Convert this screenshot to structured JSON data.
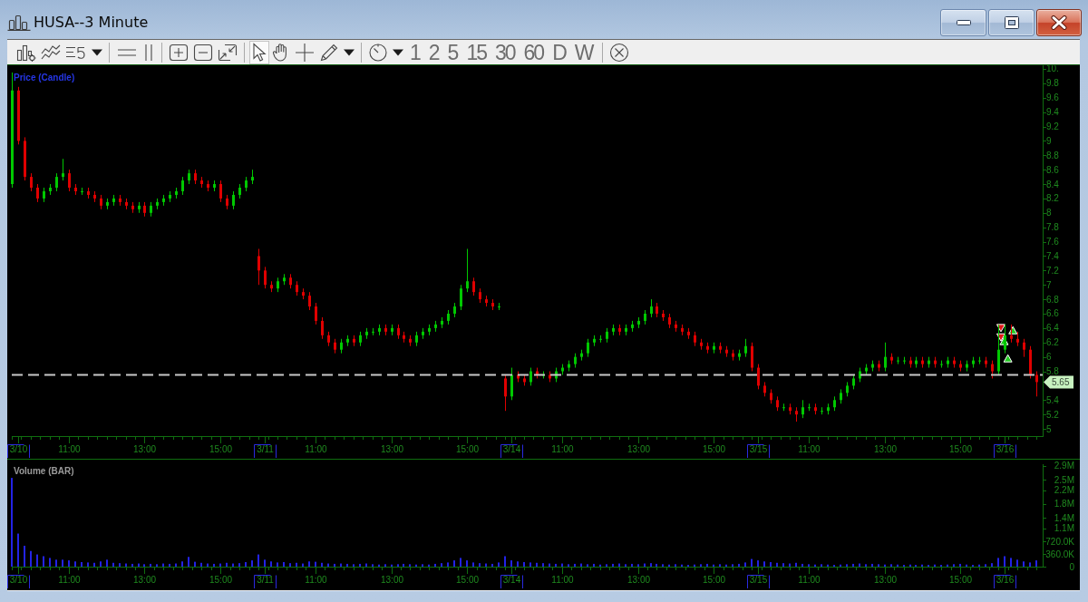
{
  "window": {
    "title": "HUSA--3 Minute"
  },
  "toolbar": {
    "tools": [
      {
        "kind": "pointer",
        "selected": true
      },
      {
        "kind": "hand",
        "selected": false
      },
      {
        "kind": "crosshair",
        "selected": false
      },
      {
        "kind": "pencil",
        "selected": false
      }
    ],
    "intervals": [
      {
        "label": "1",
        "selected": false
      },
      {
        "label": "2",
        "selected": false
      },
      {
        "label": "5",
        "selected": false
      },
      {
        "label": "15",
        "selected": false
      },
      {
        "label": "30",
        "selected": false
      },
      {
        "label": "60",
        "selected": false
      },
      {
        "label": "D",
        "selected": false
      },
      {
        "label": "W",
        "selected": false
      }
    ]
  },
  "price_panel": {
    "trade_markers": [
      {
        "kind": "sell"
      },
      {
        "kind": "sell"
      },
      {
        "kind": "buy"
      },
      {
        "kind": "buy"
      },
      {
        "kind": "buy"
      }
    ],
    "chart_data": {
      "type": "candlestick",
      "title": "Price (Candle)",
      "categories": [
        null,
        "3/10",
        null,
        null,
        null,
        null,
        null,
        null,
        null,
        "11:00",
        null,
        null,
        null,
        null,
        null,
        null,
        null,
        null,
        null,
        null,
        null,
        "13:00",
        null,
        null,
        null,
        null,
        null,
        null,
        null,
        null,
        null,
        null,
        null,
        "15:00",
        null,
        null,
        null,
        null,
        null,
        null,
        "3/11",
        null,
        null,
        null,
        null,
        null,
        null,
        null,
        "11:00",
        null,
        null,
        null,
        null,
        null,
        null,
        null,
        null,
        null,
        null,
        null,
        "13:00",
        null,
        null,
        null,
        null,
        null,
        null,
        null,
        null,
        null,
        null,
        null,
        "15:00",
        null,
        null,
        null,
        null,
        null,
        null,
        "3/14",
        null,
        null,
        null,
        null,
        null,
        null,
        null,
        "11:00",
        null,
        null,
        null,
        null,
        null,
        null,
        null,
        null,
        null,
        null,
        null,
        "13:00",
        null,
        null,
        null,
        null,
        null,
        null,
        null,
        null,
        null,
        null,
        null,
        "15:00",
        null,
        null,
        null,
        null,
        null,
        null,
        "3/15",
        null,
        null,
        null,
        null,
        null,
        null,
        null,
        "11:00",
        null,
        null,
        null,
        null,
        null,
        null,
        null,
        null,
        null,
        null,
        null,
        "13:00",
        null,
        null,
        null,
        null,
        null,
        null,
        null,
        null,
        null,
        null,
        null,
        "15:00",
        null,
        null,
        null,
        null,
        null,
        null,
        "3/16",
        null,
        null,
        null,
        null,
        null
      ],
      "ohlc": [
        [
          8.4,
          9.95,
          8.35,
          9.7
        ],
        [
          9.7,
          9.75,
          8.95,
          9.0
        ],
        [
          9.0,
          9.05,
          8.45,
          8.5
        ],
        [
          8.5,
          8.55,
          8.3,
          8.35
        ],
        [
          8.35,
          8.4,
          8.15,
          8.2
        ],
        [
          8.2,
          8.35,
          8.15,
          8.3
        ],
        [
          8.3,
          8.4,
          8.25,
          8.35
        ],
        [
          8.35,
          8.55,
          8.3,
          8.5
        ],
        [
          8.5,
          8.75,
          8.45,
          8.55
        ],
        [
          8.55,
          8.6,
          8.3,
          8.35
        ],
        [
          8.35,
          8.4,
          8.25,
          8.3
        ],
        [
          8.3,
          8.35,
          8.25,
          8.3
        ],
        [
          8.3,
          8.35,
          8.2,
          8.25
        ],
        [
          8.25,
          8.3,
          8.15,
          8.2
        ],
        [
          8.2,
          8.25,
          8.05,
          8.1
        ],
        [
          8.1,
          8.2,
          8.05,
          8.15
        ],
        [
          8.15,
          8.25,
          8.1,
          8.2
        ],
        [
          8.2,
          8.25,
          8.1,
          8.15
        ],
        [
          8.15,
          8.2,
          8.05,
          8.1
        ],
        [
          8.1,
          8.15,
          8.0,
          8.05
        ],
        [
          8.05,
          8.15,
          8.0,
          8.1
        ],
        [
          8.1,
          8.15,
          7.95,
          8.0
        ],
        [
          8.0,
          8.15,
          7.95,
          8.1
        ],
        [
          8.1,
          8.2,
          8.05,
          8.15
        ],
        [
          8.15,
          8.25,
          8.1,
          8.2
        ],
        [
          8.2,
          8.3,
          8.15,
          8.25
        ],
        [
          8.25,
          8.35,
          8.2,
          8.3
        ],
        [
          8.3,
          8.5,
          8.25,
          8.45
        ],
        [
          8.45,
          8.6,
          8.4,
          8.55
        ],
        [
          8.55,
          8.6,
          8.4,
          8.45
        ],
        [
          8.45,
          8.5,
          8.35,
          8.4
        ],
        [
          8.4,
          8.45,
          8.3,
          8.35
        ],
        [
          8.35,
          8.45,
          8.3,
          8.4
        ],
        [
          8.4,
          8.45,
          8.15,
          8.2
        ],
        [
          8.2,
          8.25,
          8.05,
          8.1
        ],
        [
          8.1,
          8.3,
          8.05,
          8.25
        ],
        [
          8.25,
          8.4,
          8.2,
          8.35
        ],
        [
          8.35,
          8.5,
          8.3,
          8.45
        ],
        [
          8.45,
          8.6,
          8.4,
          8.5
        ],
        [
          7.4,
          7.5,
          7.0,
          7.2
        ],
        [
          7.2,
          7.25,
          6.95,
          7.0
        ],
        [
          7.0,
          7.05,
          6.9,
          6.95
        ],
        [
          6.95,
          7.1,
          6.9,
          7.05
        ],
        [
          7.05,
          7.15,
          7.0,
          7.1
        ],
        [
          7.1,
          7.15,
          6.95,
          7.0
        ],
        [
          7.0,
          7.05,
          6.85,
          6.9
        ],
        [
          6.9,
          6.95,
          6.8,
          6.85
        ],
        [
          6.85,
          6.9,
          6.65,
          6.7
        ],
        [
          6.7,
          6.75,
          6.45,
          6.5
        ],
        [
          6.5,
          6.55,
          6.25,
          6.3
        ],
        [
          6.3,
          6.35,
          6.15,
          6.2
        ],
        [
          6.2,
          6.25,
          6.05,
          6.1
        ],
        [
          6.1,
          6.25,
          6.05,
          6.2
        ],
        [
          6.2,
          6.3,
          6.15,
          6.25
        ],
        [
          6.25,
          6.3,
          6.15,
          6.2
        ],
        [
          6.2,
          6.35,
          6.15,
          6.3
        ],
        [
          6.3,
          6.4,
          6.25,
          6.35
        ],
        [
          6.35,
          6.4,
          6.3,
          6.35
        ],
        [
          6.35,
          6.45,
          6.3,
          6.4
        ],
        [
          6.4,
          6.45,
          6.3,
          6.35
        ],
        [
          6.35,
          6.45,
          6.3,
          6.4
        ],
        [
          6.4,
          6.45,
          6.25,
          6.3
        ],
        [
          6.3,
          6.35,
          6.2,
          6.25
        ],
        [
          6.25,
          6.3,
          6.15,
          6.2
        ],
        [
          6.2,
          6.35,
          6.15,
          6.3
        ],
        [
          6.3,
          6.4,
          6.25,
          6.35
        ],
        [
          6.35,
          6.45,
          6.3,
          6.4
        ],
        [
          6.4,
          6.5,
          6.35,
          6.45
        ],
        [
          6.45,
          6.55,
          6.4,
          6.5
        ],
        [
          6.5,
          6.65,
          6.45,
          6.6
        ],
        [
          6.6,
          6.75,
          6.55,
          6.7
        ],
        [
          6.7,
          7.0,
          6.65,
          6.95
        ],
        [
          6.95,
          7.5,
          6.9,
          7.05
        ],
        [
          7.05,
          7.1,
          6.85,
          6.9
        ],
        [
          6.9,
          6.95,
          6.75,
          6.8
        ],
        [
          6.8,
          6.85,
          6.7,
          6.75
        ],
        [
          6.75,
          6.8,
          6.65,
          6.7
        ],
        [
          6.7,
          6.75,
          6.65,
          6.7
        ],
        [
          5.7,
          5.75,
          5.25,
          5.45
        ],
        [
          5.45,
          5.85,
          5.4,
          5.75
        ],
        [
          5.75,
          5.8,
          5.65,
          5.7
        ],
        [
          5.7,
          5.75,
          5.6,
          5.65
        ],
        [
          5.65,
          5.85,
          5.6,
          5.8
        ],
        [
          5.8,
          5.85,
          5.7,
          5.75
        ],
        [
          5.75,
          5.8,
          5.7,
          5.75
        ],
        [
          5.75,
          5.8,
          5.65,
          5.7
        ],
        [
          5.7,
          5.85,
          5.65,
          5.8
        ],
        [
          5.8,
          5.9,
          5.75,
          5.85
        ],
        [
          5.85,
          5.95,
          5.8,
          5.9
        ],
        [
          5.9,
          6.05,
          5.85,
          6.0
        ],
        [
          6.0,
          6.1,
          5.95,
          6.05
        ],
        [
          6.05,
          6.25,
          6.0,
          6.2
        ],
        [
          6.2,
          6.3,
          6.15,
          6.25
        ],
        [
          6.25,
          6.3,
          6.2,
          6.25
        ],
        [
          6.25,
          6.4,
          6.2,
          6.35
        ],
        [
          6.35,
          6.45,
          6.3,
          6.4
        ],
        [
          6.4,
          6.45,
          6.3,
          6.35
        ],
        [
          6.35,
          6.45,
          6.3,
          6.4
        ],
        [
          6.4,
          6.5,
          6.35,
          6.45
        ],
        [
          6.45,
          6.55,
          6.4,
          6.5
        ],
        [
          6.5,
          6.65,
          6.45,
          6.6
        ],
        [
          6.6,
          6.8,
          6.55,
          6.7
        ],
        [
          6.7,
          6.75,
          6.55,
          6.6
        ],
        [
          6.6,
          6.65,
          6.5,
          6.55
        ],
        [
          6.55,
          6.6,
          6.4,
          6.45
        ],
        [
          6.45,
          6.5,
          6.35,
          6.4
        ],
        [
          6.4,
          6.45,
          6.3,
          6.35
        ],
        [
          6.35,
          6.4,
          6.25,
          6.3
        ],
        [
          6.3,
          6.35,
          6.15,
          6.2
        ],
        [
          6.2,
          6.25,
          6.1,
          6.15
        ],
        [
          6.15,
          6.2,
          6.05,
          6.1
        ],
        [
          6.1,
          6.2,
          6.05,
          6.15
        ],
        [
          6.15,
          6.2,
          6.05,
          6.1
        ],
        [
          6.1,
          6.15,
          6.0,
          6.05
        ],
        [
          6.05,
          6.1,
          5.95,
          6.0
        ],
        [
          6.0,
          6.1,
          5.95,
          6.05
        ],
        [
          6.05,
          6.25,
          6.0,
          6.15
        ],
        [
          6.15,
          6.2,
          5.8,
          5.85
        ],
        [
          5.85,
          5.9,
          5.55,
          5.6
        ],
        [
          5.6,
          5.65,
          5.45,
          5.5
        ],
        [
          5.5,
          5.55,
          5.35,
          5.4
        ],
        [
          5.4,
          5.45,
          5.25,
          5.3
        ],
        [
          5.3,
          5.35,
          5.25,
          5.3
        ],
        [
          5.3,
          5.35,
          5.2,
          5.25
        ],
        [
          5.25,
          5.3,
          5.1,
          5.2
        ],
        [
          5.2,
          5.4,
          5.15,
          5.3
        ],
        [
          5.3,
          5.35,
          5.25,
          5.3
        ],
        [
          5.3,
          5.35,
          5.2,
          5.25
        ],
        [
          5.25,
          5.3,
          5.2,
          5.25
        ],
        [
          5.25,
          5.35,
          5.2,
          5.3
        ],
        [
          5.3,
          5.45,
          5.25,
          5.4
        ],
        [
          5.4,
          5.55,
          5.35,
          5.5
        ],
        [
          5.5,
          5.65,
          5.45,
          5.6
        ],
        [
          5.6,
          5.75,
          5.55,
          5.7
        ],
        [
          5.7,
          5.85,
          5.65,
          5.8
        ],
        [
          5.8,
          5.9,
          5.75,
          5.85
        ],
        [
          5.85,
          5.95,
          5.8,
          5.9
        ],
        [
          5.9,
          5.95,
          5.8,
          5.85
        ],
        [
          5.85,
          6.2,
          5.8,
          6.0
        ],
        [
          6.0,
          6.05,
          5.9,
          5.95
        ],
        [
          5.95,
          6.0,
          5.9,
          5.95
        ],
        [
          5.95,
          6.0,
          5.9,
          5.95
        ],
        [
          5.95,
          6.0,
          5.85,
          5.9
        ],
        [
          5.9,
          6.0,
          5.85,
          5.95
        ],
        [
          5.95,
          6.0,
          5.85,
          5.9
        ],
        [
          5.9,
          6.0,
          5.85,
          5.95
        ],
        [
          5.95,
          6.0,
          5.85,
          5.9
        ],
        [
          5.9,
          5.95,
          5.85,
          5.9
        ],
        [
          5.9,
          6.0,
          5.85,
          5.95
        ],
        [
          5.95,
          6.0,
          5.85,
          5.9
        ],
        [
          5.9,
          5.95,
          5.8,
          5.85
        ],
        [
          5.85,
          5.95,
          5.8,
          5.9
        ],
        [
          5.9,
          6.0,
          5.85,
          5.95
        ],
        [
          5.95,
          6.0,
          5.9,
          5.95
        ],
        [
          5.95,
          6.0,
          5.85,
          5.9
        ],
        [
          5.9,
          5.95,
          5.7,
          5.8
        ],
        [
          5.8,
          6.45,
          5.75,
          6.1
        ],
        [
          6.1,
          6.45,
          6.05,
          6.3
        ],
        [
          6.3,
          6.45,
          6.2,
          6.25
        ],
        [
          6.25,
          6.35,
          6.15,
          6.2
        ],
        [
          6.2,
          6.25,
          6.0,
          6.1
        ],
        [
          6.1,
          6.15,
          5.7,
          5.75
        ],
        [
          5.75,
          5.8,
          5.45,
          5.65
        ]
      ],
      "ylim": [
        4.9,
        10.05
      ],
      "yticks": [
        5,
        5.2,
        5.4,
        5.8,
        6,
        6.2,
        6.4,
        6.6,
        6.8,
        7,
        7.2,
        7.4,
        7.6,
        7.8,
        8,
        8.2,
        8.4,
        8.6,
        8.8,
        9,
        9.2,
        9.4,
        9.6,
        9.8,
        {
          "value": 10,
          "label": "10."
        }
      ],
      "ref_lines": [
        {
          "axis": "y",
          "value": 5.76
        }
      ],
      "annotations": [
        "5.65"
      ]
    }
  },
  "volume_panel": {
    "chart_data": {
      "type": "bar",
      "title": "Volume (BAR)",
      "categories": [
        null,
        "3/10",
        null,
        null,
        null,
        null,
        null,
        null,
        null,
        "11:00",
        null,
        null,
        null,
        null,
        null,
        null,
        null,
        null,
        null,
        null,
        null,
        "13:00",
        null,
        null,
        null,
        null,
        null,
        null,
        null,
        null,
        null,
        null,
        null,
        "15:00",
        null,
        null,
        null,
        null,
        null,
        null,
        "3/11",
        null,
        null,
        null,
        null,
        null,
        null,
        null,
        "11:00",
        null,
        null,
        null,
        null,
        null,
        null,
        null,
        null,
        null,
        null,
        null,
        "13:00",
        null,
        null,
        null,
        null,
        null,
        null,
        null,
        null,
        null,
        null,
        null,
        "15:00",
        null,
        null,
        null,
        null,
        null,
        null,
        "3/14",
        null,
        null,
        null,
        null,
        null,
        null,
        null,
        "11:00",
        null,
        null,
        null,
        null,
        null,
        null,
        null,
        null,
        null,
        null,
        null,
        "13:00",
        null,
        null,
        null,
        null,
        null,
        null,
        null,
        null,
        null,
        null,
        null,
        "15:00",
        null,
        null,
        null,
        null,
        null,
        null,
        "3/15",
        null,
        null,
        null,
        null,
        null,
        null,
        null,
        "11:00",
        null,
        null,
        null,
        null,
        null,
        null,
        null,
        null,
        null,
        null,
        null,
        "13:00",
        null,
        null,
        null,
        null,
        null,
        null,
        null,
        null,
        null,
        null,
        null,
        "15:00",
        null,
        null,
        null,
        null,
        null,
        null,
        "3/16",
        null,
        null,
        null,
        null,
        null
      ],
      "series": [
        {
          "color": "#2323e6",
          "values": [
            2550000,
            950000,
            600000,
            450000,
            350000,
            300000,
            250000,
            200000,
            200000,
            180000,
            150000,
            130000,
            120000,
            110000,
            150000,
            200000,
            110000,
            100000,
            90000,
            80000,
            90000,
            70000,
            80000,
            70000,
            90000,
            80000,
            90000,
            150000,
            280000,
            140000,
            110000,
            90000,
            80000,
            90000,
            110000,
            90000,
            100000,
            130000,
            180000,
            350000,
            200000,
            150000,
            120000,
            130000,
            100000,
            110000,
            90000,
            150000,
            140000,
            110000,
            90000,
            80000,
            90000,
            80000,
            70000,
            80000,
            90000,
            70000,
            60000,
            70000,
            60000,
            70000,
            80000,
            70000,
            60000,
            70000,
            60000,
            80000,
            100000,
            120000,
            180000,
            250000,
            180000,
            120000,
            100000,
            90000,
            80000,
            120000,
            300000,
            180000,
            150000,
            130000,
            120000,
            110000,
            100000,
            90000,
            80000,
            90000,
            70000,
            80000,
            90000,
            70000,
            80000,
            60000,
            70000,
            80000,
            90000,
            70000,
            80000,
            70000,
            90000,
            100000,
            80000,
            70000,
            60000,
            70000,
            60000,
            50000,
            60000,
            70000,
            80000,
            60000,
            70000,
            60000,
            70000,
            80000,
            120000,
            220000,
            180000,
            150000,
            130000,
            110000,
            100000,
            90000,
            110000,
            80000,
            70000,
            60000,
            70000,
            60000,
            50000,
            60000,
            70000,
            80000,
            90000,
            70000,
            80000,
            70000,
            60000,
            70000,
            60000,
            50000,
            60000,
            50000,
            60000,
            50000,
            60000,
            50000,
            60000,
            70000,
            80000,
            60000,
            50000,
            60000,
            70000,
            100000,
            250000,
            300000,
            250000,
            200000,
            150000,
            120000,
            180000
          ]
        }
      ],
      "ylim": [
        0,
        3100000
      ],
      "yticks": [
        0,
        {
          "value": 360000,
          "label": "360.0K"
        },
        {
          "value": 720000,
          "label": "720.0K"
        },
        {
          "value": 1100000,
          "label": "1.1M"
        },
        {
          "value": 1400000,
          "label": "1.4M"
        },
        {
          "value": 1800000,
          "label": "1.8M"
        },
        {
          "value": 2200000,
          "label": "2.2M"
        },
        {
          "value": 2500000,
          "label": "2.5M"
        },
        {
          "value": 2900000,
          "label": "2.9M"
        }
      ]
    }
  }
}
